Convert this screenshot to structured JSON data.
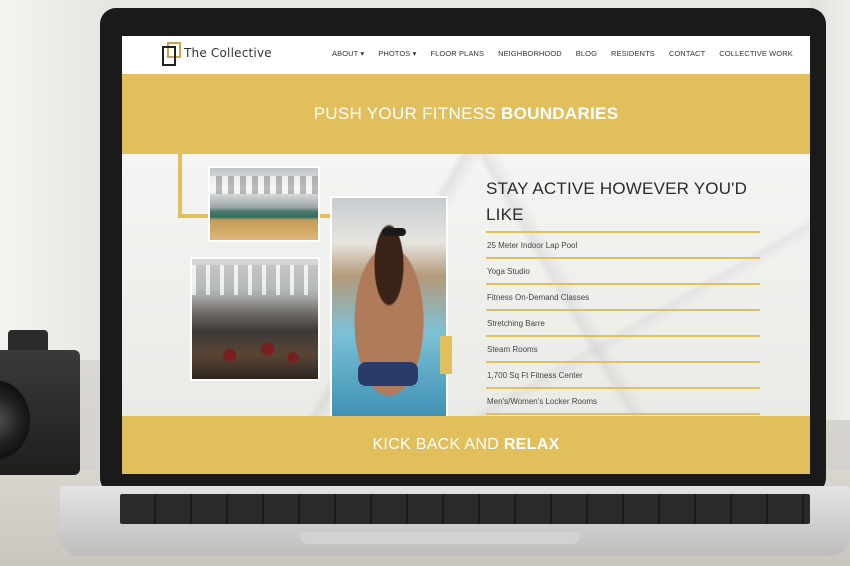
{
  "site": {
    "logo_text": "The Collective"
  },
  "nav": {
    "items": [
      "ABOUT ▾",
      "PHOTOS ▾",
      "FLOOR PLANS",
      "NEIGHBORHOOD",
      "BLOG",
      "RESIDENTS",
      "CONTACT",
      "COLLECTIVE WORK"
    ]
  },
  "hero": {
    "text_regular": "PUSH YOUR FITNESS ",
    "text_bold": "BOUNDARIES"
  },
  "section": {
    "title": "STAY ACTIVE HOWEVER YOU'D LIKE",
    "amenities": [
      "25 Meter Indoor Lap Pool",
      "Yoga Studio",
      "Fitness On-Demand Classes",
      "Stretching Barre",
      "Steam Rooms",
      "1,700 Sq Ft Fitness Center",
      "Men's/Women's Locker Rooms"
    ]
  },
  "footer_banner": {
    "text_regular": "KICK BACK AND ",
    "text_bold": "RELAX"
  },
  "icons": {
    "accessibility": "accessibility-icon"
  },
  "colors": {
    "accent_gold": "#e1bf5c",
    "accessibility_blue": "#1f5fd9"
  }
}
